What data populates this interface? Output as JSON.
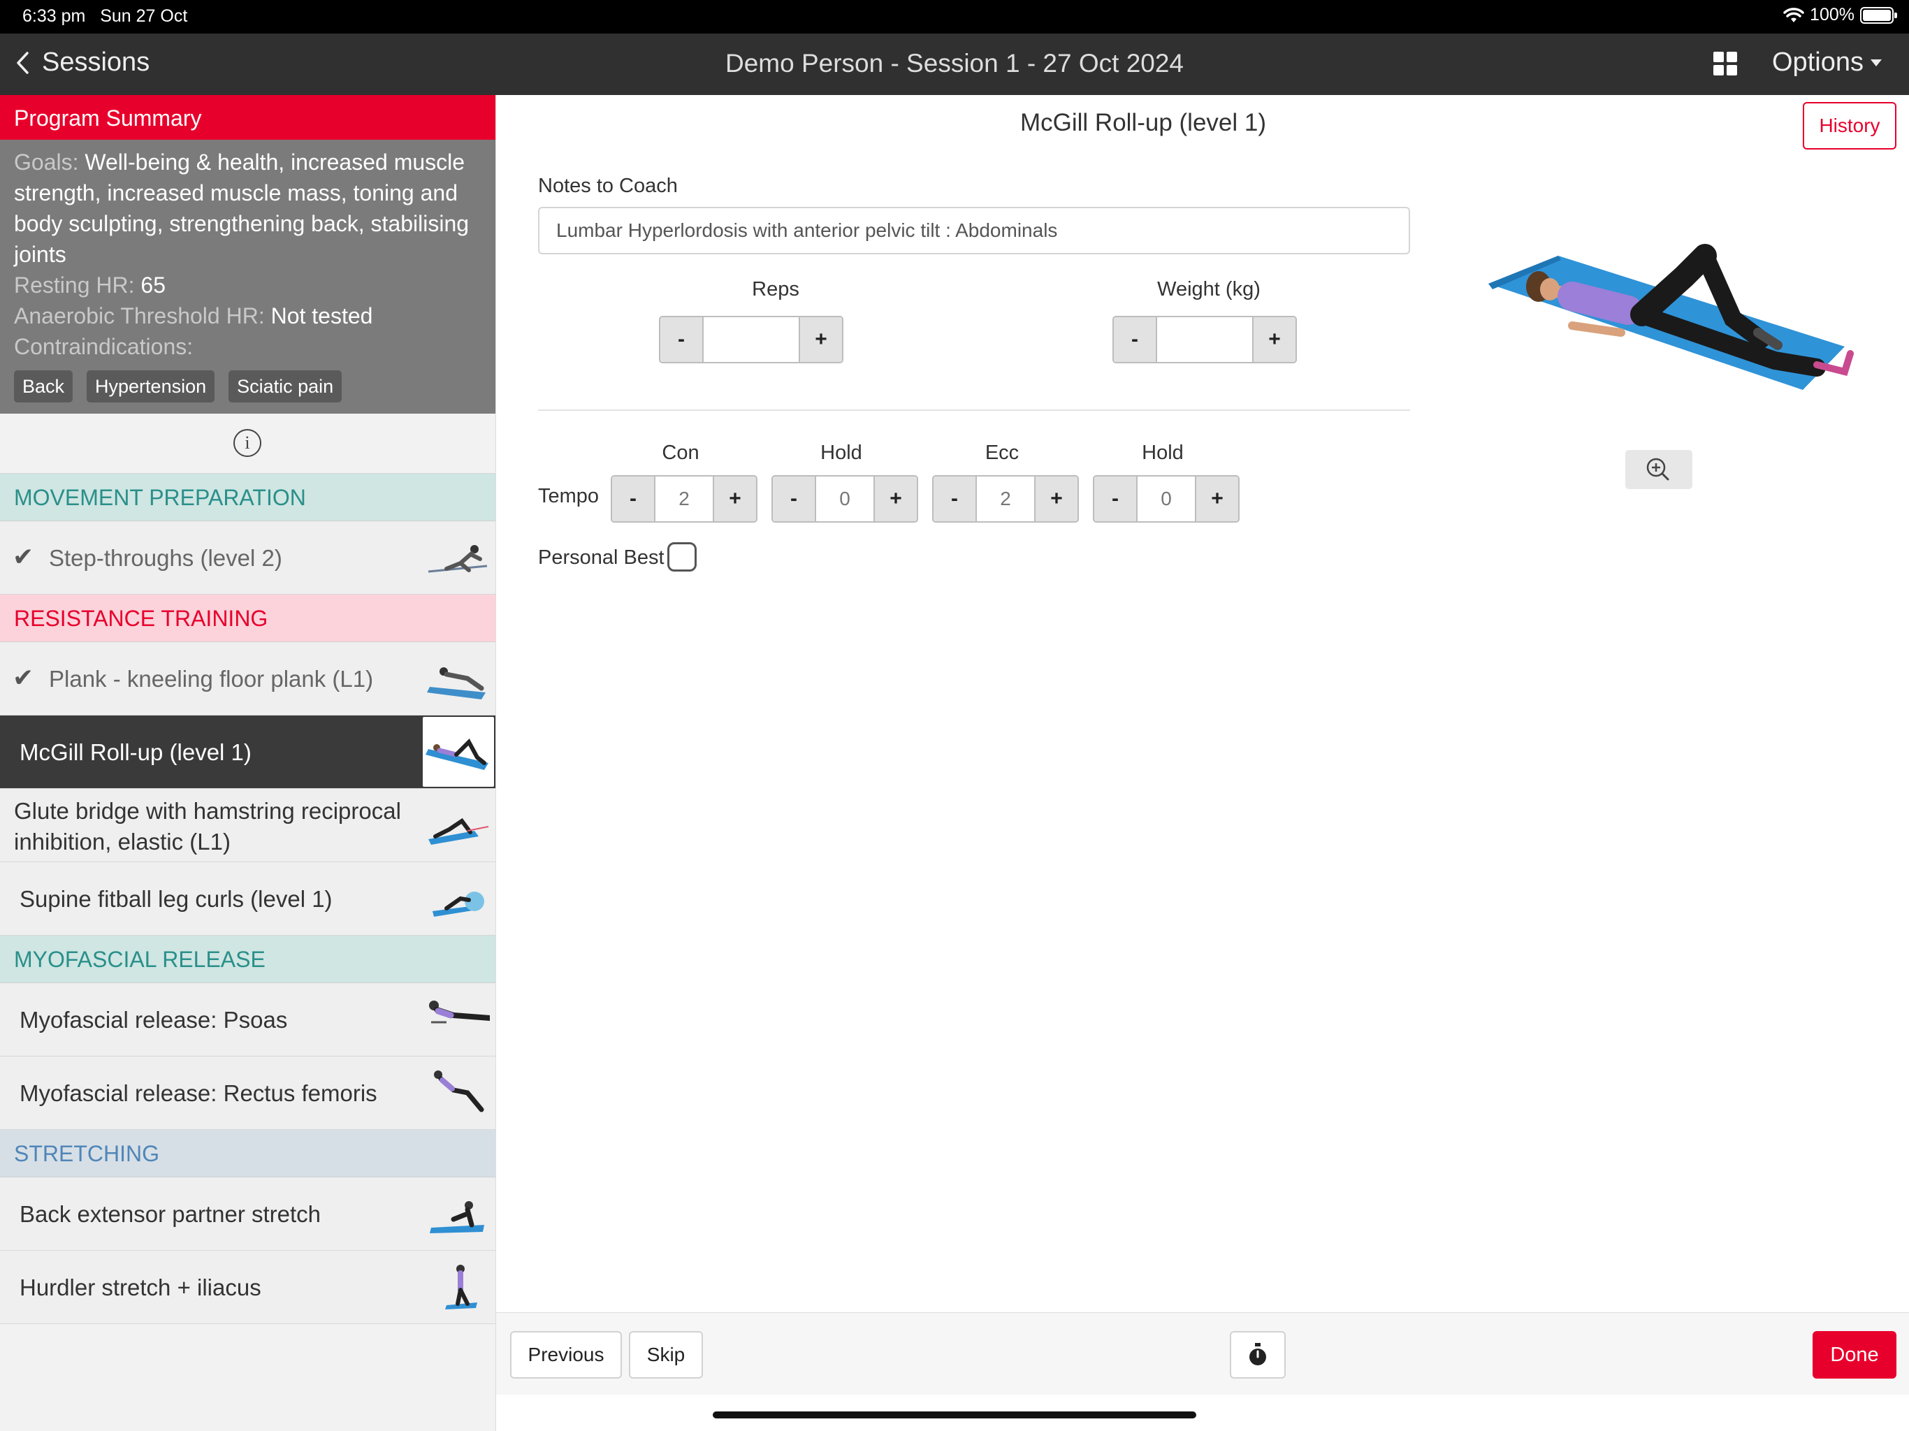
{
  "status_bar": {
    "time": "6:33 pm",
    "date": "Sun 27 Oct",
    "battery": "100%"
  },
  "nav": {
    "back_label": "Sessions",
    "title": "Demo Person - Session 1 - 27 Oct 2024",
    "options_label": "Options"
  },
  "summary": {
    "header": "Program Summary",
    "goals_label": "Goals:",
    "goals_value": "Well-being & health, increased muscle strength, increased muscle mass, toning and body sculpting, strengthening back, stabilising joints",
    "resting_hr_label": "Resting HR:",
    "resting_hr_value": "65",
    "at_hr_label": "Anaerobic Threshold HR:",
    "at_hr_value": "Not tested",
    "contra_label": "Contraindications:",
    "contraindications": [
      "Back",
      "Hypertension",
      "Sciatic pain"
    ]
  },
  "sections": {
    "movement": "MOVEMENT PREPARATION",
    "resistance": "RESISTANCE TRAINING",
    "myofascial": "MYOFASCIAL RELEASE",
    "stretching": "STRETCHING"
  },
  "exercises": [
    {
      "label": "Step-throughs (level 2)",
      "done": true
    },
    {
      "label": "Plank - kneeling floor plank (L1)",
      "done": true
    },
    {
      "label": "McGill Roll-up (level 1)",
      "active": true
    },
    {
      "label": "Glute bridge with hamstring reciprocal inhibition, elastic (L1)"
    },
    {
      "label": "Supine fitball leg curls (level 1)"
    },
    {
      "label": "Myofascial release: Psoas"
    },
    {
      "label": "Myofascial release: Rectus femoris"
    },
    {
      "label": "Back extensor partner stretch"
    },
    {
      "label": "Hurdler stretch + iliacus"
    }
  ],
  "detail": {
    "title": "McGill Roll-up (level 1)",
    "history_label": "History",
    "notes_label": "Notes to Coach",
    "notes_value": "Lumbar Hyperlordosis with anterior pelvic tilt : Abdominals",
    "reps_label": "Reps",
    "reps_value": "",
    "weight_label": "Weight (kg)",
    "weight_value": "",
    "tempo_label": "Tempo",
    "tempo": [
      {
        "label": "Con",
        "value": "2"
      },
      {
        "label": "Hold",
        "value": "0"
      },
      {
        "label": "Ecc",
        "value": "2"
      },
      {
        "label": "Hold",
        "value": "0"
      }
    ],
    "minus": "-",
    "plus": "+",
    "personal_best_label": "Personal Best",
    "personal_best_checked": false
  },
  "toolbar": {
    "previous": "Previous",
    "skip": "Skip",
    "done": "Done"
  },
  "colors": {
    "accent": "#e8002c",
    "nav": "#303030",
    "teal": "#2a8f8a",
    "blue": "#4f86b8"
  }
}
